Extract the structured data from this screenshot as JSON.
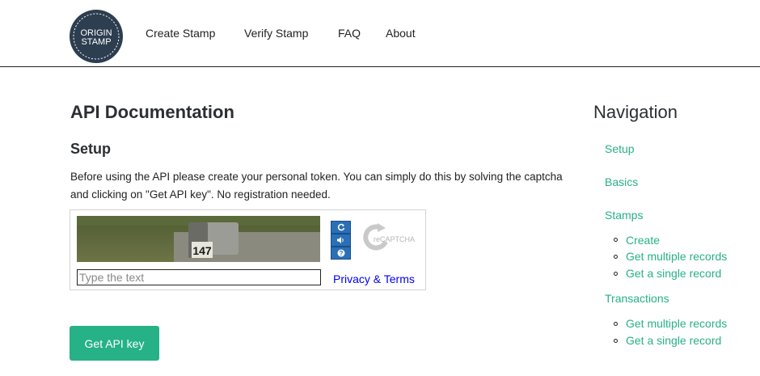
{
  "header": {
    "logo_top": "ORIGIN",
    "logo_bottom": "STAMP",
    "nav": [
      "Create Stamp",
      "Verify Stamp",
      "FAQ",
      "About"
    ]
  },
  "main": {
    "title": "API Documentation",
    "section_title": "Setup",
    "intro": "Before using the API please create your personal token. You can simply do this by solving the captcha and clicking on \"Get API key\". No registration needed.",
    "captcha": {
      "image_text": "147",
      "input_placeholder": "Type the text",
      "privacy_link": "Privacy & Terms",
      "logo_text": "reCAPTCHA"
    },
    "api_button": "Get API key"
  },
  "sidebar": {
    "title": "Navigation",
    "setup": "Setup",
    "basics": "Basics",
    "stamps": "Stamps",
    "stamps_items": [
      "Create",
      "Get multiple records",
      "Get a single record"
    ],
    "transactions": "Transactions",
    "transactions_items": [
      "Get multiple records",
      "Get a single record"
    ]
  },
  "colors": {
    "accent": "#26b186",
    "link": "#0000ee",
    "captcha_button": "#2a6fb8"
  }
}
